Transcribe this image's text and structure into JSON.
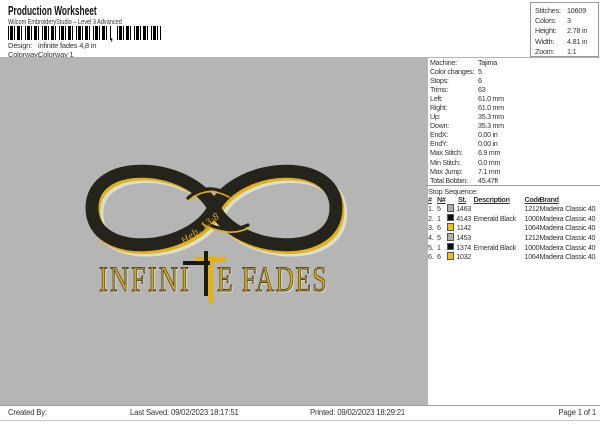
{
  "header": {
    "title": "Production Worksheet",
    "subtitle": "Wilcom EmbroideryStudio – Level 3 Advanced",
    "barcode_separator": ",",
    "design_label": "Design:",
    "design_value": "infinite fades 4,8 in",
    "colorway_label": "Colorway:",
    "colorway_value": "Colorway 1"
  },
  "stats": {
    "rows": [
      {
        "label": "Stitches:",
        "value": "10609"
      },
      {
        "label": "Colors:",
        "value": "3"
      },
      {
        "label": "Height:",
        "value": "2.78 in"
      },
      {
        "label": "Width:",
        "value": "4.81 in"
      },
      {
        "label": "Zoom:",
        "value": "1:1"
      }
    ]
  },
  "machine_info": {
    "rows": [
      {
        "label": "Machine:",
        "value": "Tajima"
      },
      {
        "label": "Color changes:",
        "value": "5"
      },
      {
        "label": "Stops:",
        "value": "6"
      },
      {
        "label": "Trims:",
        "value": "63"
      },
      {
        "label": "Left:",
        "value": "61.0 mm"
      },
      {
        "label": "Right:",
        "value": "61.0 mm"
      },
      {
        "label": "Up:",
        "value": "35.3 mm"
      },
      {
        "label": "Down:",
        "value": "35.3 mm"
      },
      {
        "label": "EndX:",
        "value": "0.00 in"
      },
      {
        "label": "EndY:",
        "value": "0.00 in"
      },
      {
        "label": "Max Stitch:",
        "value": "6.9 mm"
      },
      {
        "label": "Min Stitch:",
        "value": "0.0 mm"
      },
      {
        "label": "Max Jump:",
        "value": "7.1 mm"
      },
      {
        "label": "Total Bobbin:",
        "value": "45.47ft"
      }
    ]
  },
  "stop_sequence": {
    "title": "Stop Sequence:",
    "headers": {
      "num": "#",
      "needle": "N#",
      "st": "St.",
      "description": "Description",
      "code": "Code",
      "brand": "Brand"
    },
    "rows": [
      {
        "num": "1.",
        "needle": "5",
        "color": "#a9b2ab",
        "st": "1463",
        "description": "",
        "code": "1212",
        "brand": "Madeira Classic 40"
      },
      {
        "num": "2.",
        "needle": "1",
        "color": "#0d0d0d",
        "st": "4143",
        "description": "Emerald Black",
        "code": "1000",
        "brand": "Madeira Classic 40"
      },
      {
        "num": "3.",
        "needle": "6",
        "color": "#f0bf16",
        "st": "1142",
        "description": "",
        "code": "1064",
        "brand": "Madeira Classic 40"
      },
      {
        "num": "4.",
        "needle": "5",
        "color": "#a9b2ab",
        "st": "1453",
        "description": "",
        "code": "1212",
        "brand": "Madeira Classic 40"
      },
      {
        "num": "5.",
        "needle": "1",
        "color": "#0d0d0d",
        "st": "1374",
        "description": "Emerald Black",
        "code": "1000",
        "brand": "Madeira Classic 40"
      },
      {
        "num": "6.",
        "needle": "6",
        "color": "#f0bf16",
        "st": "1032",
        "description": "",
        "code": "1064",
        "brand": "Madeira Classic 40"
      }
    ]
  },
  "artwork": {
    "verse": "Heb. 13:8",
    "wordmark_left": "INFINI",
    "wordmark_right": "E FADES",
    "colors": {
      "band": "#25241c",
      "gold": "#e4b211",
      "silver": "#d9ded9",
      "background": "#b5b5b3"
    }
  },
  "footer": {
    "created_by": "Created By:",
    "last_saved": "Last Saved: 09/02/2023 18:17:51",
    "printed": "Printed: 09/02/2023 18:29:21",
    "page": "Page 1 of 1"
  }
}
